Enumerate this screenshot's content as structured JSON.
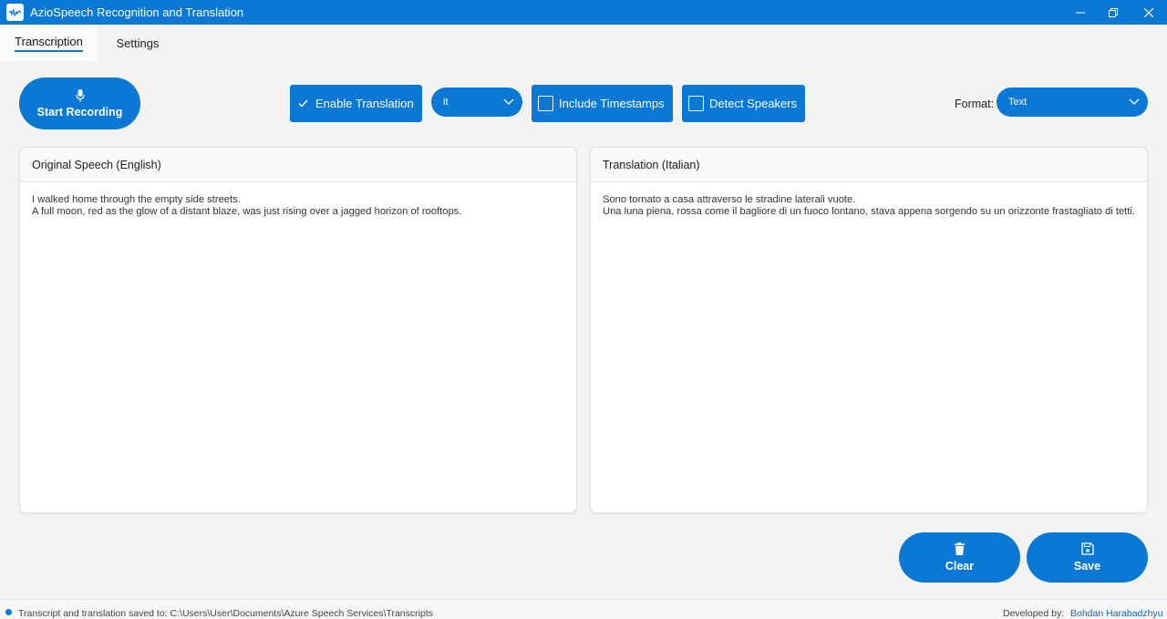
{
  "window": {
    "title": "AzioSpeech Recognition and Translation",
    "accent_color": "#0a78d4"
  },
  "tabs": [
    {
      "label": "Transcription",
      "active": true
    },
    {
      "label": "Settings",
      "active": false
    }
  ],
  "controls": {
    "record_label": "Start Recording",
    "enable_translation_label": "Enable Translation",
    "enable_translation_checked": true,
    "language_value": "it",
    "timestamps_label": "Include Timestamps",
    "timestamps_checked": false,
    "speakers_label": "Detect Speakers",
    "speakers_checked": false,
    "format_label": "Format:",
    "format_value": "Text"
  },
  "panels": {
    "original": {
      "title": "Original Speech (English)",
      "text": "I walked home through the empty side streets.\nA full moon, red as the glow of a distant blaze, was just rising over a jagged horizon of rooftops."
    },
    "translation": {
      "title": "Translation (Italian)",
      "text": "Sono tornato a casa attraverso le stradine laterali vuote.\nUna luna piena, rossa come il bagliore di un fuoco lontano, stava appena sorgendo su un orizzonte frastagliato di tetti."
    }
  },
  "actions": {
    "clear_label": "Clear",
    "save_label": "Save"
  },
  "status": {
    "message": "Transcript and translation saved to: C:\\Users\\User\\Documents\\Azure Speech Services\\Transcripts",
    "developer_label": "Developed by:",
    "developer_name": "Bohdan Harabadzhyu"
  }
}
